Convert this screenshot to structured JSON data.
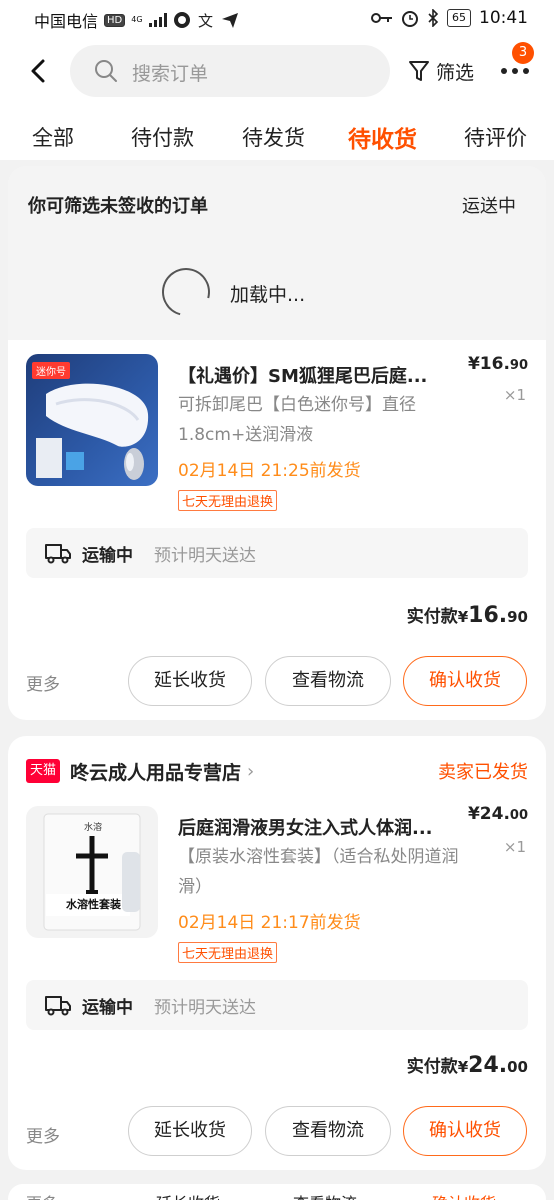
{
  "status_bar": {
    "carrier": "中国电信",
    "hd": "HD",
    "network": "4G",
    "battery": "65",
    "time": "10:41"
  },
  "header": {
    "search_placeholder": "搜索订单",
    "filter_label": "筛选",
    "more_badge": "3"
  },
  "tabs": [
    {
      "label": "全部"
    },
    {
      "label": "待付款"
    },
    {
      "label": "待发货"
    },
    {
      "label": "待收货",
      "active": true
    },
    {
      "label": "待评价"
    }
  ],
  "filter_panel": {
    "tip": "你可筛选未签收的订单",
    "shipping_filter": "运送中",
    "loading_text": "加载中..."
  },
  "orders": [
    {
      "thumb_badge": "迷你号",
      "title": "【礼遇价】SM狐狸尾巴后庭...",
      "spec": "可拆卸尾巴【白色迷你号】直径1.8cm+送润滑液",
      "delivery": "02月14日 21:25前发货",
      "tag": "七天无理由退换",
      "price_main": "¥16.",
      "price_cents": "90",
      "qty": "×1",
      "track_status": "运输中",
      "track_eta": "预计明天送达",
      "paid_label": "实付款",
      "paid_currency": "¥",
      "paid_main": "16.",
      "paid_cents": "90",
      "more": "更多",
      "btn_extend": "延长收货",
      "btn_logistics": "查看物流",
      "btn_confirm": "确认收货"
    },
    {
      "shop_badge": "天猫",
      "shop_name": "咚云成人用品专营店",
      "shop_status": "卖家已发货",
      "thumb_labels": [
        "水溶",
        "水溶性套装"
      ],
      "title": "后庭润滑液男女注入式人体润...",
      "spec": "【原装水溶性套装】（适合私处阴道润滑）",
      "delivery": "02月14日 21:17前发货",
      "tag": "七天无理由退换",
      "price_main": "¥24.",
      "price_cents": "00",
      "qty": "×1",
      "track_status": "运输中",
      "track_eta": "预计明天送达",
      "paid_label": "实付款",
      "paid_currency": "¥",
      "paid_main": "24.",
      "paid_cents": "00",
      "more": "更多",
      "btn_extend": "延长收货",
      "btn_logistics": "查看物流",
      "btn_confirm": "确认收货"
    }
  ],
  "partial_row": {
    "more": "更多",
    "btn_extend": "延长收货",
    "btn_logistics": "查看物流",
    "btn_confirm": "确认收货"
  },
  "colors": {
    "accent": "#ff5000",
    "delivery": "#ff8c1a",
    "tmall": "#ff0036"
  }
}
